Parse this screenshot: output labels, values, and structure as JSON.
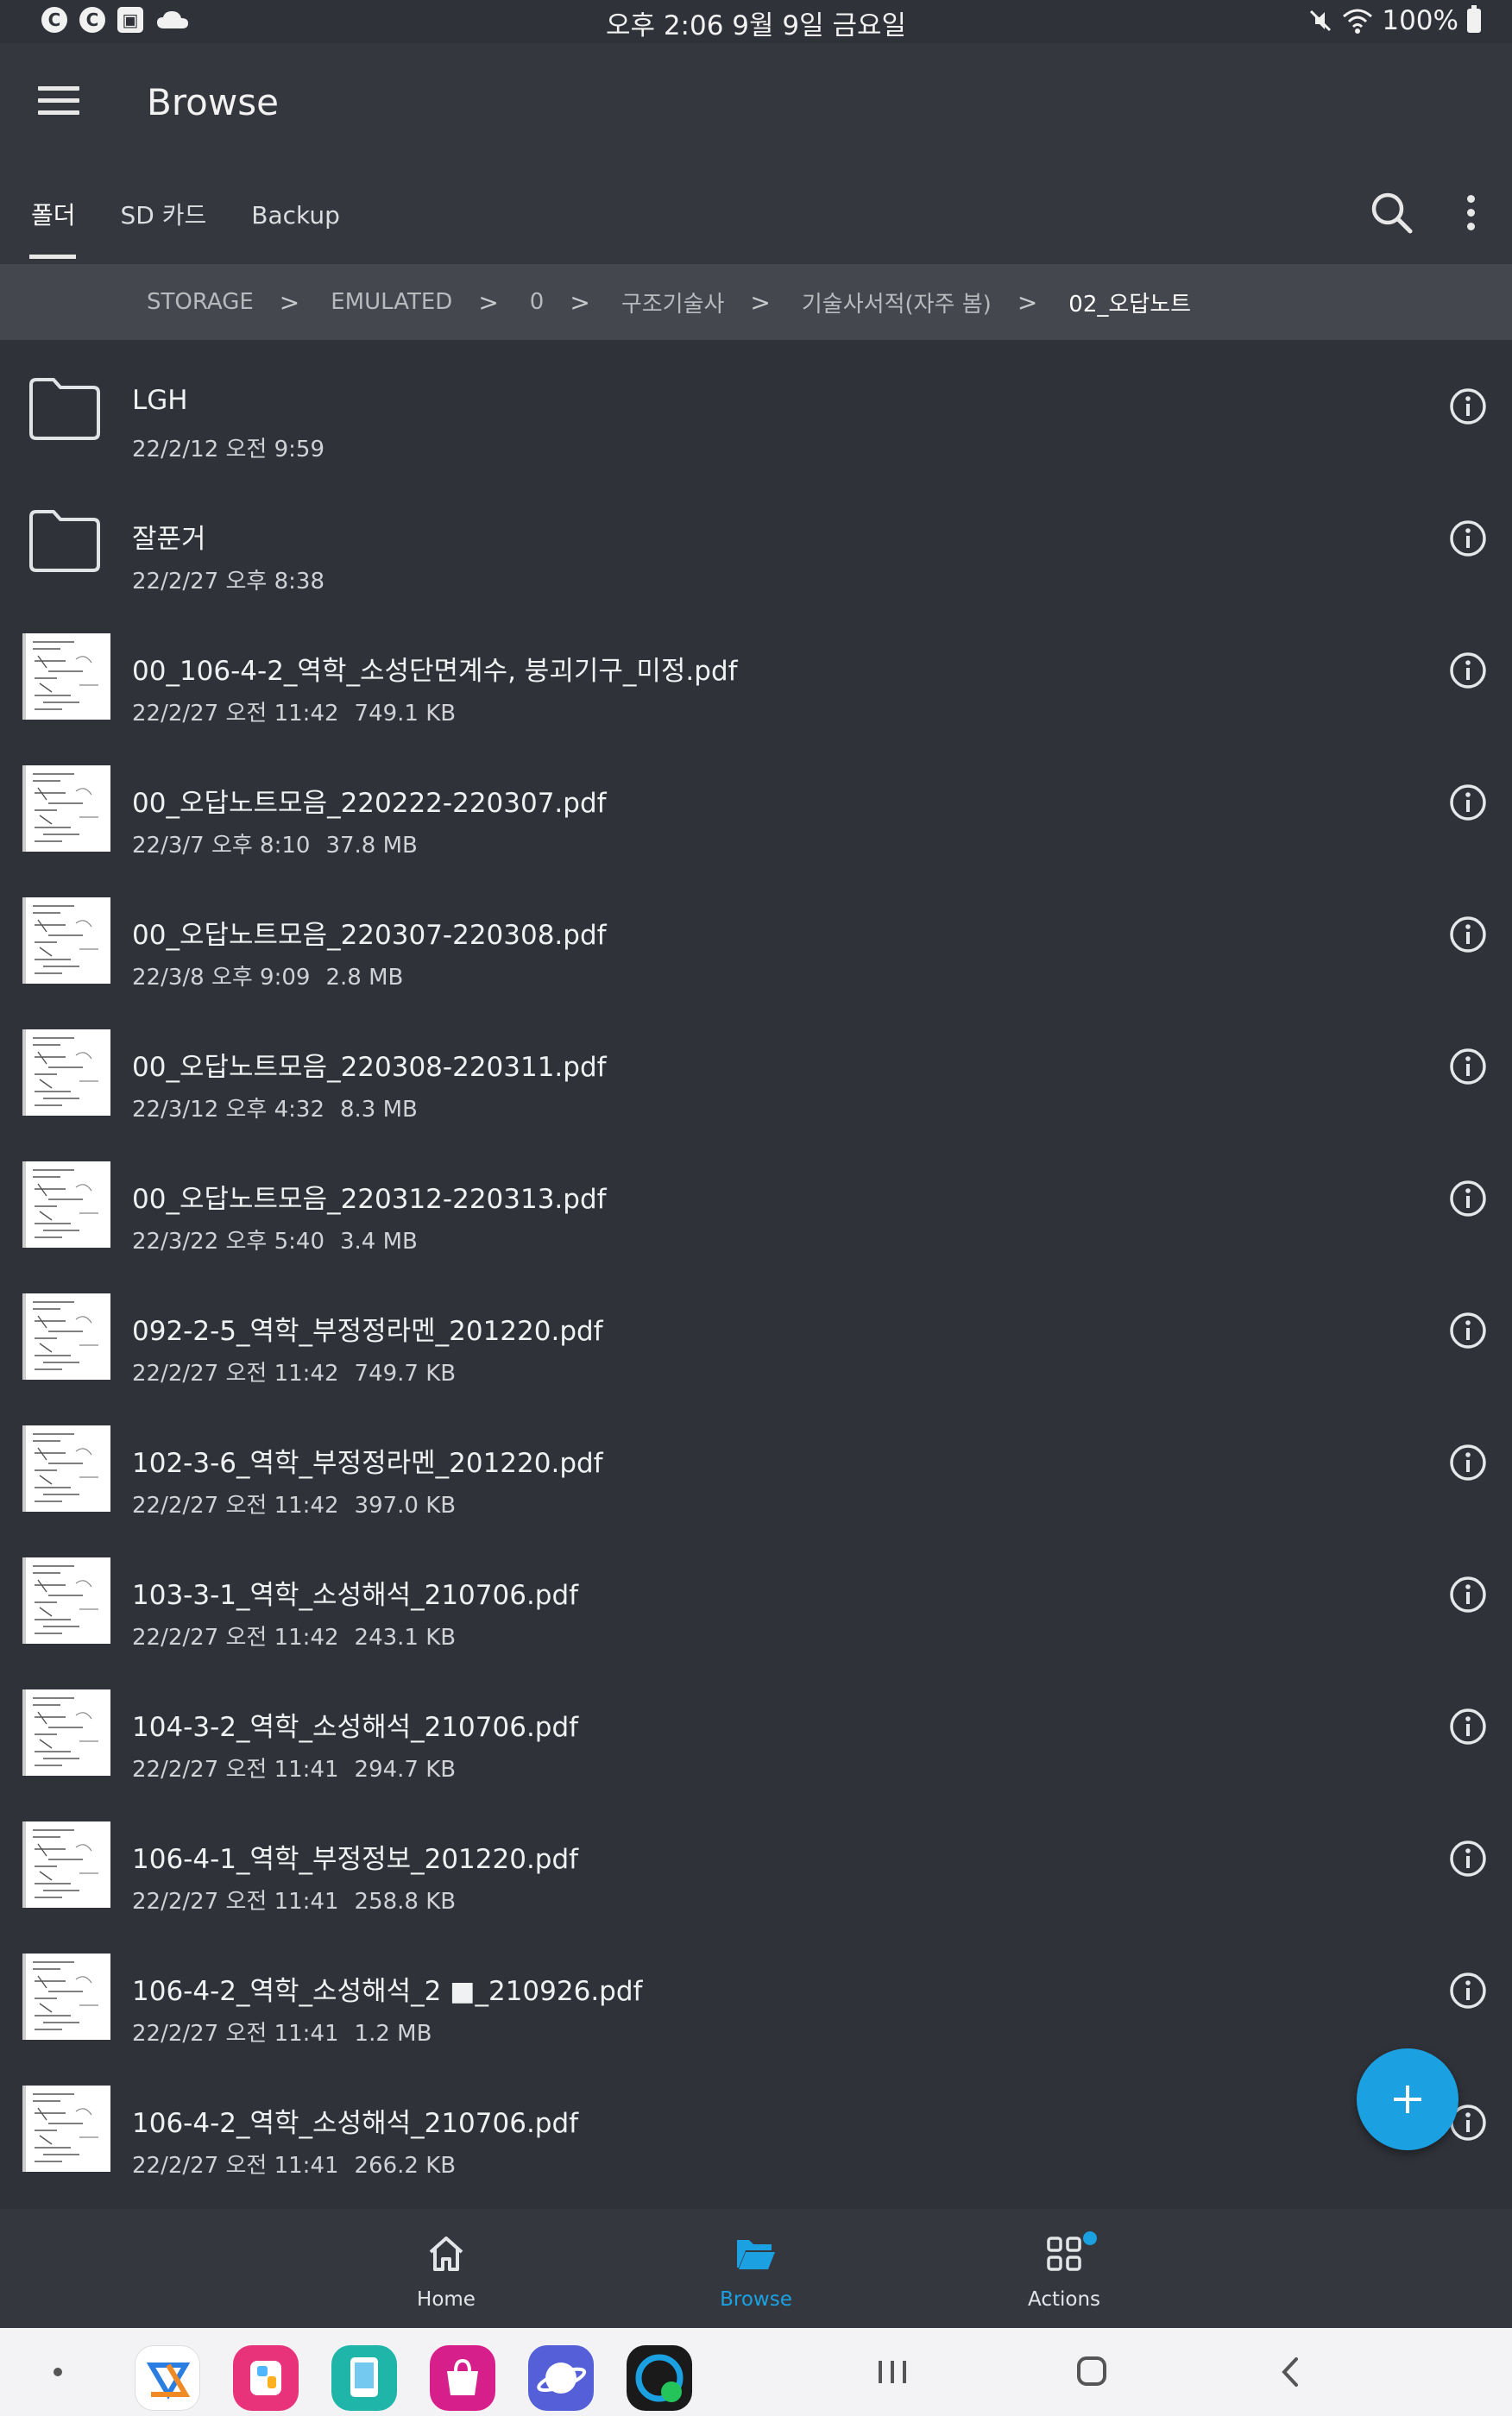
{
  "status_bar": {
    "left_badges": [
      "C",
      "C",
      "▣"
    ],
    "time_date": "오후 2:06  9월 9일 금요일",
    "battery": "100%"
  },
  "app_bar": {
    "title": "Browse",
    "tabs": [
      {
        "label": "폴더",
        "active": true
      },
      {
        "label": "SD 카드",
        "active": false
      },
      {
        "label": "Backup",
        "active": false
      }
    ]
  },
  "breadcrumb": {
    "items": [
      "STORAGE",
      "EMULATED",
      "0",
      "구조기술사",
      "기술사서적(자주 봄)",
      "02_오답노트"
    ],
    "separator": ">"
  },
  "files": [
    {
      "type": "folder",
      "name": "LGH",
      "date": "22/2/12 오전 9:59",
      "size": ""
    },
    {
      "type": "folder",
      "name": "잘푼거",
      "date": "22/2/27 오후 8:38",
      "size": ""
    },
    {
      "type": "pdf",
      "name": "00_106-4-2_역학_소성단면계수, 붕괴기구_미정.pdf",
      "date": "22/2/27 오전 11:42",
      "size": "749.1 KB"
    },
    {
      "type": "pdf",
      "name": "00_오답노트모음_220222-220307.pdf",
      "date": "22/3/7 오후 8:10",
      "size": "37.8 MB"
    },
    {
      "type": "pdf",
      "name": "00_오답노트모음_220307-220308.pdf",
      "date": "22/3/8 오후 9:09",
      "size": "2.8 MB"
    },
    {
      "type": "pdf",
      "name": "00_오답노트모음_220308-220311.pdf",
      "date": "22/3/12 오후 4:32",
      "size": "8.3 MB"
    },
    {
      "type": "pdf",
      "name": "00_오답노트모음_220312-220313.pdf",
      "date": "22/3/22 오후 5:40",
      "size": "3.4 MB"
    },
    {
      "type": "pdf",
      "name": "092-2-5_역학_부정정라멘_201220.pdf",
      "date": "22/2/27 오전 11:42",
      "size": "749.7 KB"
    },
    {
      "type": "pdf",
      "name": "102-3-6_역학_부정정라멘_201220.pdf",
      "date": "22/2/27 오전 11:42",
      "size": "397.0 KB"
    },
    {
      "type": "pdf",
      "name": "103-3-1_역학_소성해석_210706.pdf",
      "date": "22/2/27 오전 11:42",
      "size": "243.1 KB"
    },
    {
      "type": "pdf",
      "name": "104-3-2_역학_소성해석_210706.pdf",
      "date": "22/2/27 오전 11:41",
      "size": "294.7 KB"
    },
    {
      "type": "pdf",
      "name": "106-4-1_역학_부정정보_201220.pdf",
      "date": "22/2/27 오전 11:41",
      "size": "258.8 KB"
    },
    {
      "type": "pdf",
      "name": "106-4-2_역학_소성해석_2 ■_210926.pdf",
      "date": "22/2/27 오전 11:41",
      "size": "1.2 MB"
    },
    {
      "type": "pdf",
      "name": "106-4-2_역학_소성해석_210706.pdf",
      "date": "22/2/27 오전 11:41",
      "size": "266.2 KB"
    }
  ],
  "fab": {
    "icon": "plus-icon"
  },
  "bottom_nav": [
    {
      "label": "Home",
      "icon": "home-icon",
      "active": false
    },
    {
      "label": "Browse",
      "icon": "folder-open-icon",
      "active": true
    },
    {
      "label": "Actions",
      "icon": "grid-icon",
      "active": false,
      "badge": true
    }
  ],
  "colors": {
    "background": "#2f3238",
    "appbar": "#34373d",
    "breadcrumb_bg": "#44474d",
    "accent": "#1ba1e2"
  }
}
